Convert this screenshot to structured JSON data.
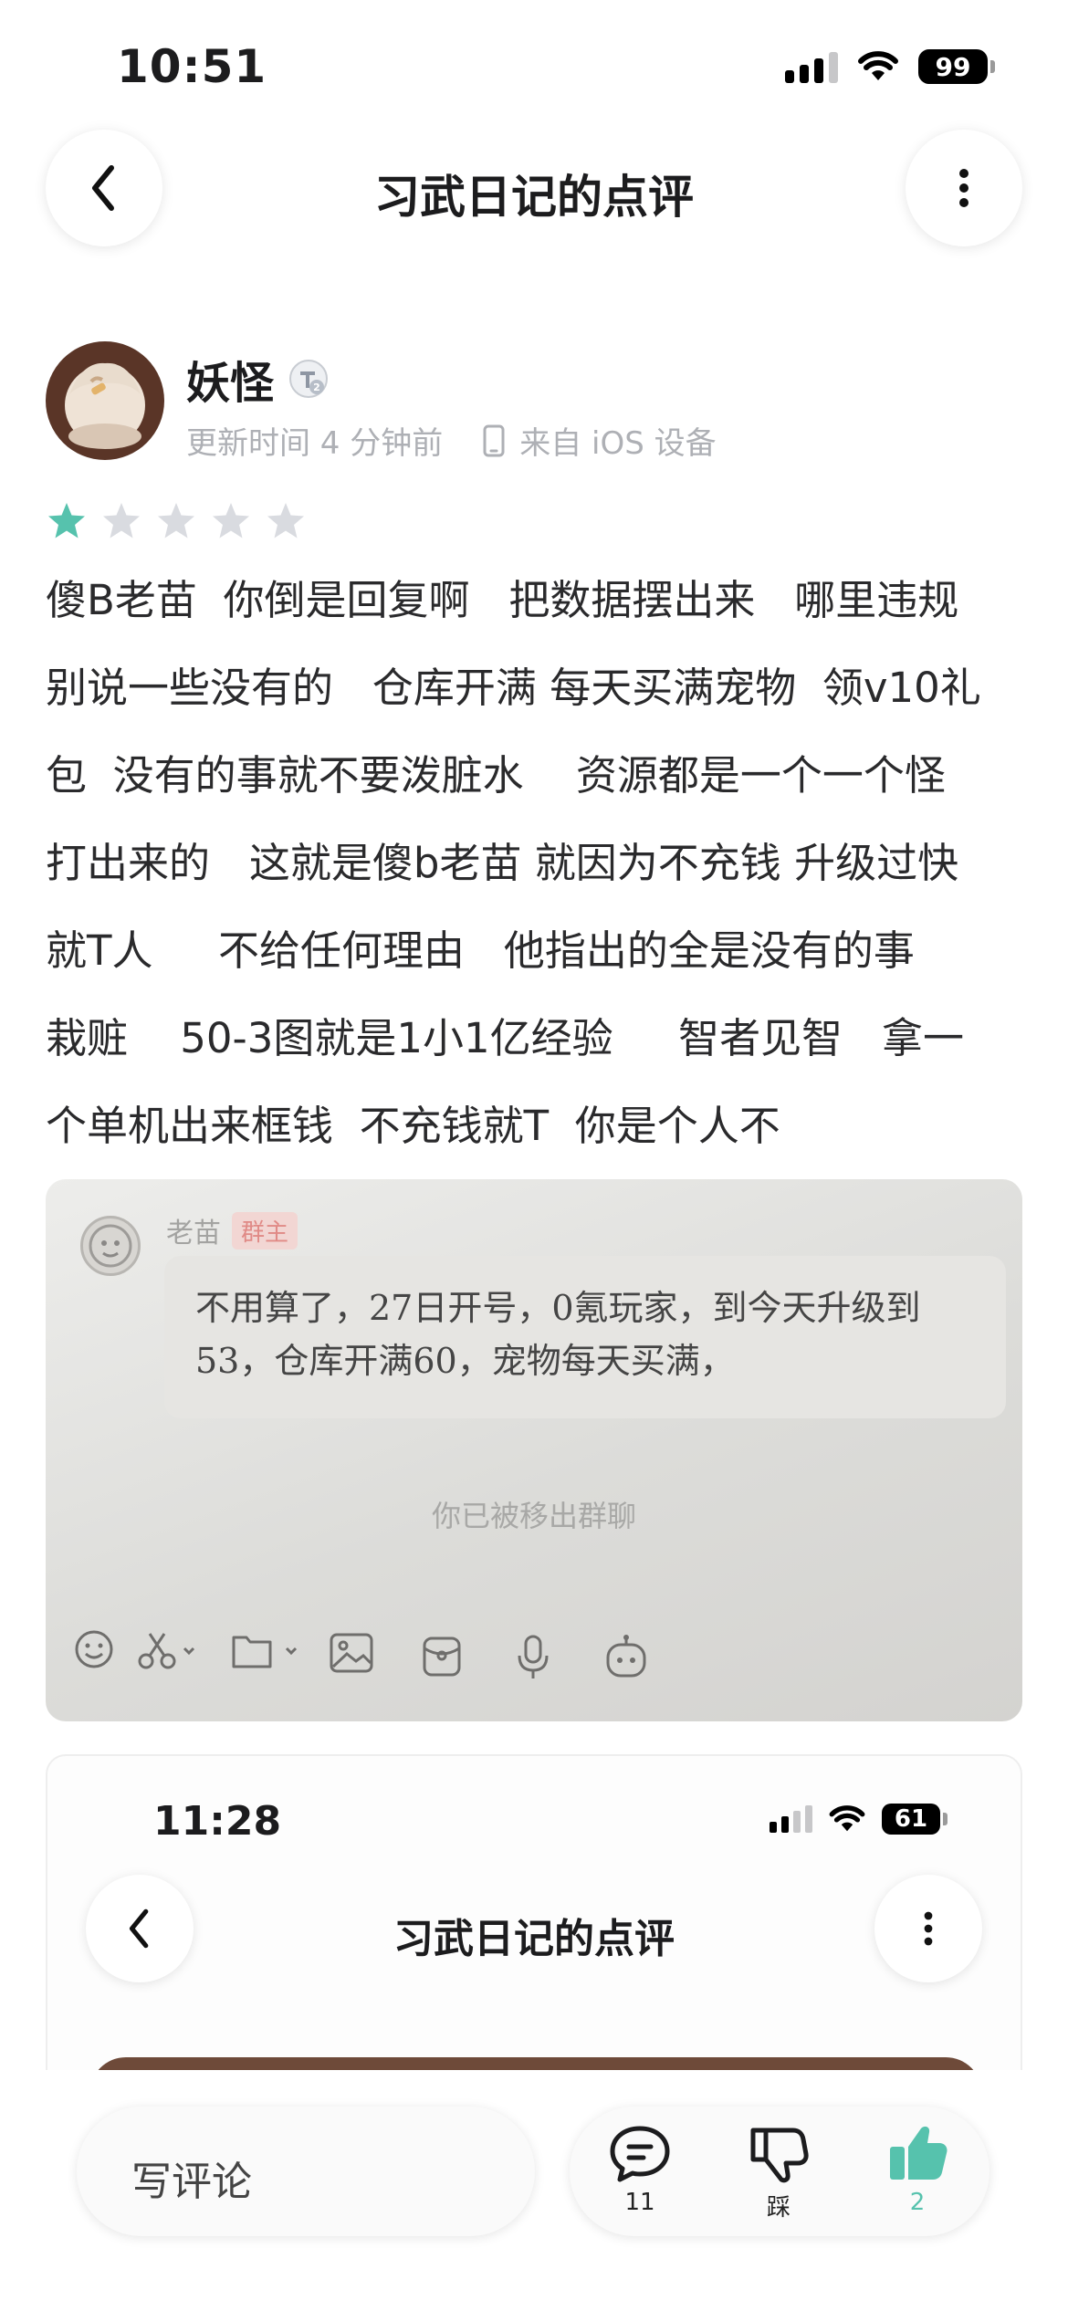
{
  "status_bar": {
    "time": "10:51",
    "battery": "99"
  },
  "header": {
    "title": "习武日记的点评"
  },
  "author": {
    "name": "妖怪",
    "updated": "更新时间 4 分钟前",
    "device": "来自 iOS 设备"
  },
  "rating": {
    "value": 1,
    "max": 5,
    "active_color": "#56c2ad",
    "inactive_color": "#d9dbe0"
  },
  "review": {
    "lines": [
      "傻B老苗  你倒是回复啊   把数据摆出来   哪里违规",
      "别说一些没有的   仓库开满 每天买满宠物  领v10礼",
      "包  没有的事就不要泼脏水    资源都是一个一个怪",
      "打出来的   这就是傻b老苗 就因为不充钱 升级过快",
      "就T人     不给任何理由   他指出的全是没有的事",
      "栽赃    50-3图就是1小1亿经验     智者见智   拿一",
      "个单机出来框钱  不充钱就T  你是个人不"
    ]
  },
  "photo_one": {
    "sender": "老苗",
    "sender_tag": "群主",
    "message": "不用算了，27日开号，0氪玩家，到今天升级到53，仓库开满60，宠物每天买满，",
    "system_notice": "你已被移出群聊"
  },
  "photo_two": {
    "time": "11:28",
    "battery": "61",
    "title": "习武日记的点评"
  },
  "bottom_bar": {
    "comment_placeholder": "写评论",
    "comments_count": "11",
    "dislike_label": "踩",
    "likes_count": "2"
  }
}
